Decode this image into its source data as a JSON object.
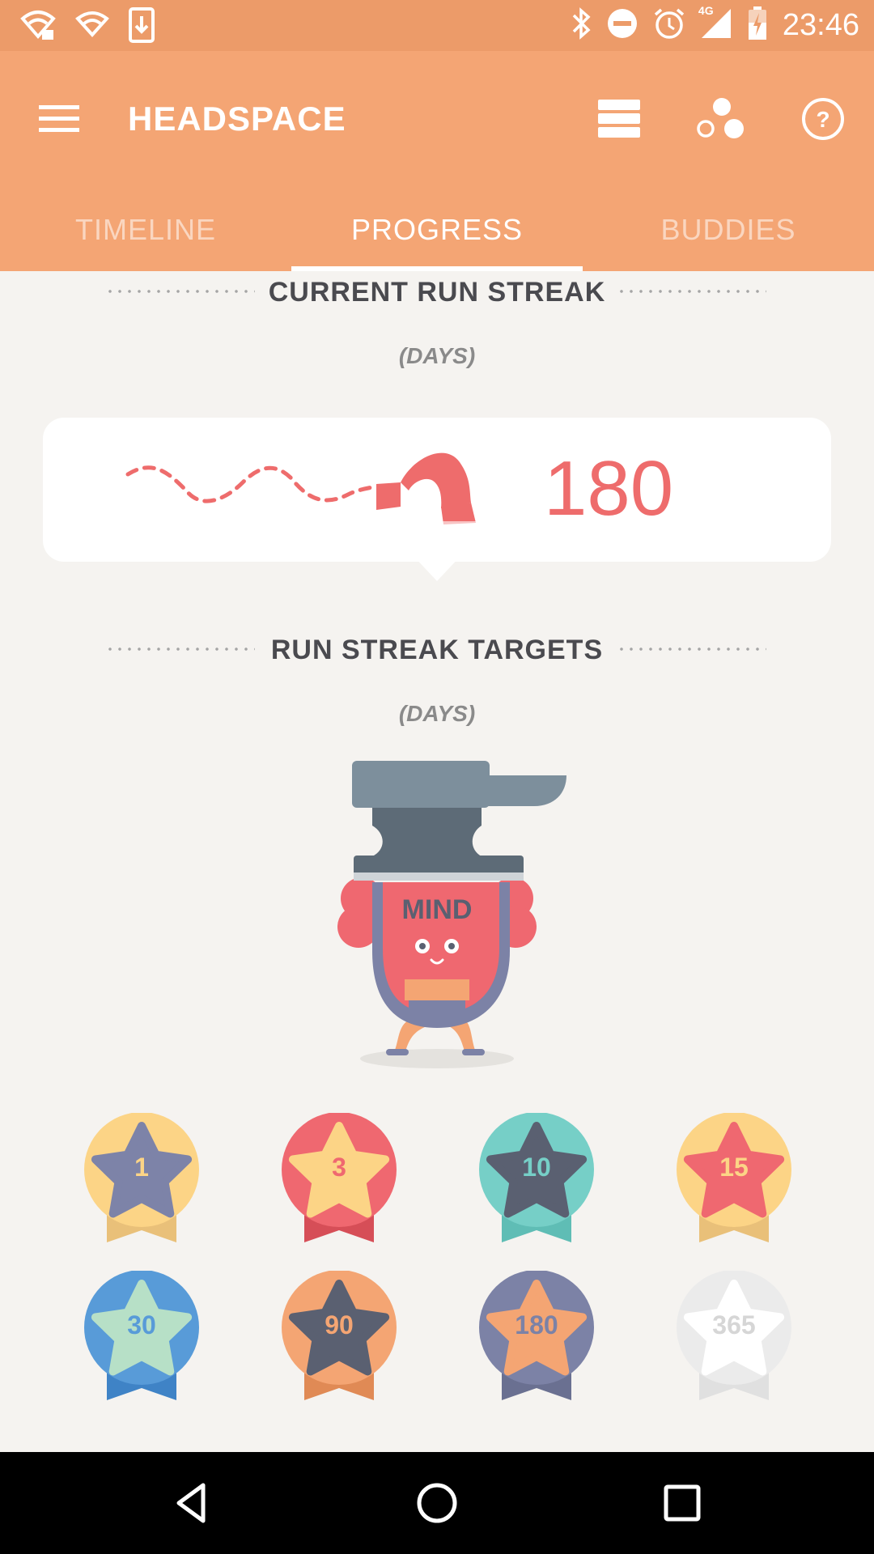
{
  "status_bar": {
    "time": "23:46",
    "network": "4G",
    "icons": [
      "wifi-lock-icon",
      "wifi-icon",
      "download-icon",
      "bluetooth-icon",
      "do-not-disturb-icon",
      "alarm-icon",
      "signal-icon",
      "battery-charging-icon"
    ]
  },
  "app_bar": {
    "title": "HEADSPACE",
    "actions": [
      "list-icon",
      "buddies-icon",
      "help-icon"
    ]
  },
  "tabs": [
    {
      "label": "TIMELINE",
      "active": false
    },
    {
      "label": "PROGRESS",
      "active": true
    },
    {
      "label": "BUDDIES",
      "active": false
    }
  ],
  "current_streak": {
    "title": "CURRENT RUN STREAK",
    "unit": "(DAYS)",
    "value": "180"
  },
  "targets": {
    "title": "RUN STREAK TARGETS",
    "unit": "(DAYS)",
    "mascot_text": "MIND",
    "badges": [
      {
        "label": "1",
        "circle": "#fcd486",
        "star": "#7d83a8",
        "ribbon": "#e9c079",
        "text": "#fcd486"
      },
      {
        "label": "3",
        "circle": "#ef6870",
        "star": "#fcd486",
        "ribbon": "#d64e57",
        "text": "#ef6870"
      },
      {
        "label": "10",
        "circle": "#76cfc7",
        "star": "#5a6071",
        "ribbon": "#5fbdb5",
        "text": "#76cfc7"
      },
      {
        "label": "15",
        "circle": "#fcd486",
        "star": "#ef6870",
        "ribbon": "#e9c079",
        "text": "#fcd486"
      },
      {
        "label": "30",
        "circle": "#589bd8",
        "star": "#b7e0c7",
        "ribbon": "#3f83c6",
        "text": "#589bd8"
      },
      {
        "label": "90",
        "circle": "#f4a573",
        "star": "#5a6071",
        "ribbon": "#e08a55",
        "text": "#f4a573"
      },
      {
        "label": "180",
        "circle": "#7c82a6",
        "star": "#f4a573",
        "ribbon": "#6a7091",
        "text": "#7c82a6"
      },
      {
        "label": "365",
        "circle": "#ebebeb",
        "star": "#ffffff",
        "ribbon": "#e0e0e0",
        "text": "#d6d6d6"
      }
    ]
  },
  "nav_bar": [
    "back-icon",
    "home-icon",
    "recents-icon"
  ]
}
